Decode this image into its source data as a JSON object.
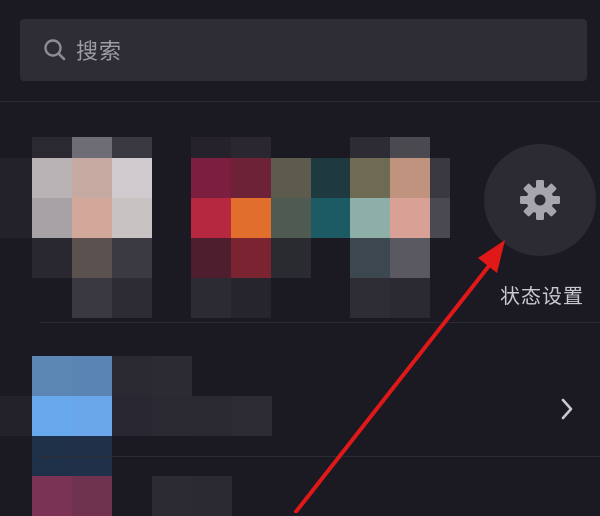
{
  "search": {
    "placeholder": "搜索",
    "icon": "search-icon"
  },
  "status_settings": {
    "label": "状态设置",
    "icon": "gear-icon"
  },
  "list_row": {
    "icon": "chevron-right-icon"
  },
  "colors": {
    "background": "#1b1a23",
    "search_bg": "#2e2d36",
    "settings_bg": "#2c2b33",
    "annotation_arrow": "#e01818"
  }
}
